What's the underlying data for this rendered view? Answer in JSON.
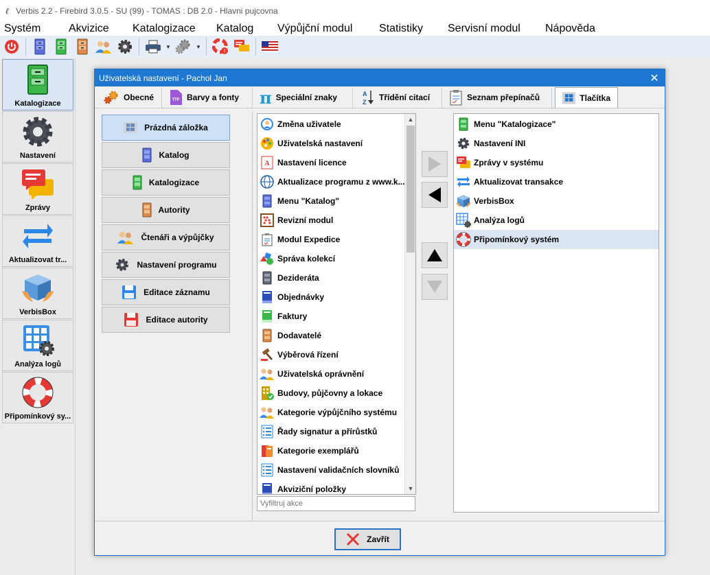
{
  "window": {
    "title": "Verbis 2.2 - Firebird 3.0.5 - SU (99) - TOMAS : DB 2.0 - Hlavni pujcovna"
  },
  "menu": [
    "Systém",
    "Akvizice",
    "Katalogizace",
    "Katalog",
    "Výpůjční modul",
    "Statistiky",
    "Servisní modul",
    "Nápověda"
  ],
  "toolbar": {
    "icons": [
      "power-icon",
      "catalog-blue-icon",
      "catalog-green-icon",
      "catalog-orange-icon",
      "users-icon",
      "gear-icon",
      "printer-icon",
      "gears-icon",
      "lifebuoy-icon",
      "messages-icon",
      "flag-icon"
    ]
  },
  "sidebar": {
    "items": [
      {
        "label": "Katalogizace",
        "icon": "cabinet-green-icon",
        "active": true
      },
      {
        "label": "Nastavení",
        "icon": "gear-icon"
      },
      {
        "label": "Zprávy",
        "icon": "messages-icon"
      },
      {
        "label": "Aktualizovat tr...",
        "icon": "sync-icon"
      },
      {
        "label": "VerbisBox",
        "icon": "box-icon"
      },
      {
        "label": "Analýza logů",
        "icon": "log-grid-icon"
      },
      {
        "label": "Připomínkový sy...",
        "icon": "lifebuoy-icon"
      }
    ]
  },
  "dialog": {
    "title": "Uživatelská nastavení - Pachol Jan",
    "tabs": [
      {
        "label": "Obecné",
        "icon": "gears-icon"
      },
      {
        "label": "Barvy a fonty",
        "icon": "ttf-icon"
      },
      {
        "label": "Speciální znaky",
        "icon": "pi-icon"
      },
      {
        "label": "Třídění citací",
        "icon": "sort-az-icon"
      },
      {
        "label": "Seznam přepínačů",
        "icon": "checklist-icon"
      },
      {
        "label": "Tlačítka",
        "icon": "windows-icon",
        "selected": true
      }
    ],
    "left_buttons": [
      {
        "label": "Prázdná záložka",
        "icon": "windows-icon",
        "selected": true
      },
      {
        "label": "Katalog",
        "icon": "cabinet-blue-icon"
      },
      {
        "label": "Katalogizace",
        "icon": "cabinet-green-icon"
      },
      {
        "label": "Autority",
        "icon": "cabinet-orange-icon"
      },
      {
        "label": "Čtenáři a výpůjčky",
        "icon": "users-icon"
      },
      {
        "label": "Nastavení programu",
        "icon": "gear-icon"
      },
      {
        "label": "Editace záznamu",
        "icon": "floppy-blue-icon"
      },
      {
        "label": "Editace autority",
        "icon": "floppy-red-icon"
      }
    ],
    "available_actions": [
      {
        "label": "Změna uživatele",
        "icon": "user-switch-icon"
      },
      {
        "label": "Uživatelská nastavení",
        "icon": "palette-icon"
      },
      {
        "label": "Nastavení licence",
        "icon": "license-icon"
      },
      {
        "label": "Aktualizace programu z www.k...",
        "icon": "globe-icon"
      },
      {
        "label": "Menu \"Katalog\"",
        "icon": "cabinet-blue-icon"
      },
      {
        "label": "Revizní modul",
        "icon": "abacus-icon"
      },
      {
        "label": "Modul Expedice",
        "icon": "checklist-icon"
      },
      {
        "label": "Správa kolekcí",
        "icon": "shapes-icon"
      },
      {
        "label": "Dezideráta",
        "icon": "cabinet-gray-icon"
      },
      {
        "label": "Objednávky",
        "icon": "book-blue-icon"
      },
      {
        "label": "Faktury",
        "icon": "book-green-icon"
      },
      {
        "label": "Dodavatelé",
        "icon": "cabinet-orange-icon"
      },
      {
        "label": "Výběrová řízení",
        "icon": "gavel-icon"
      },
      {
        "label": "Uživatelská oprávnění",
        "icon": "users-icon"
      },
      {
        "label": "Budovy, půjčovny a lokace",
        "icon": "building-icon"
      },
      {
        "label": "Kategorie výpůjčního systému",
        "icon": "users-icon"
      },
      {
        "label": "Řady signatur a přírůstků",
        "icon": "list-icon"
      },
      {
        "label": "Kategorie exemplářů",
        "icon": "books-icon"
      },
      {
        "label": "Nastavení validačních slovníků",
        "icon": "list-icon"
      },
      {
        "label": "Akviziční položky",
        "icon": "book-blue-icon"
      }
    ],
    "filter_placeholder": "Vyfiltruj akce",
    "selected_actions": [
      {
        "label": "Menu \"Katalogizace\"",
        "icon": "cabinet-green-icon"
      },
      {
        "label": "Nastavení INI",
        "icon": "gear-icon"
      },
      {
        "label": "Zprávy v systému",
        "icon": "messages-icon"
      },
      {
        "label": "Aktualizovat transakce",
        "icon": "sync-icon"
      },
      {
        "label": "VerbisBox",
        "icon": "box-icon"
      },
      {
        "label": "Analýza logů",
        "icon": "log-grid-icon"
      },
      {
        "label": "Připomínkový systém",
        "icon": "lifebuoy-icon",
        "selected": true
      }
    ],
    "close_label": "Zavřít"
  },
  "colors": {
    "accent": "#1e78d2",
    "selection": "#dbe4f1",
    "toolbar_bg": "#e7eef7"
  }
}
